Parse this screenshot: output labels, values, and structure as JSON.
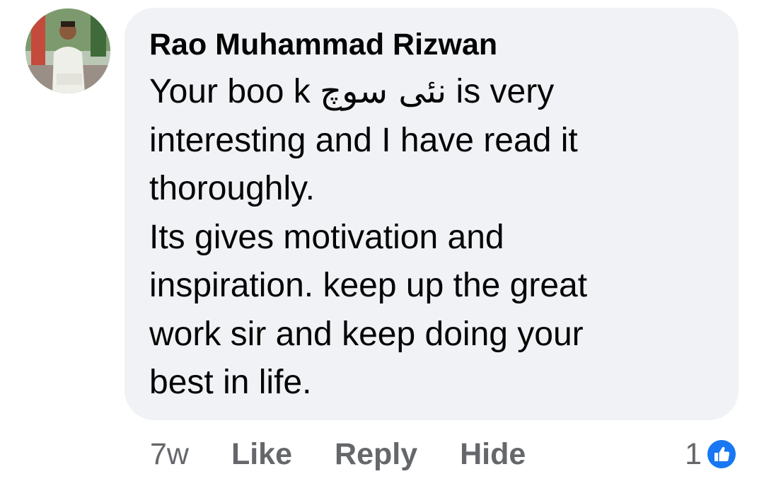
{
  "comment": {
    "author": "Rao Muhammad Rizwan",
    "line1_prefix": "Your boo k ",
    "line1_urdu": "نئی سوچ",
    "line1_suffix": " is very",
    "lines": [
      "interesting and I have read it",
      "thoroughly.",
      "Its gives motivation and",
      "inspiration. keep up the great",
      "work sir and keep doing your",
      "best in life."
    ]
  },
  "actions": {
    "timestamp": "7w",
    "like_label": "Like",
    "reply_label": "Reply",
    "hide_label": "Hide"
  },
  "reactions": {
    "count": "1",
    "icon": "like-thumbs-up-icon",
    "color": "#1877f2"
  },
  "colors": {
    "bubble": "#f0f2f5",
    "secondary_text": "#65676b",
    "primary_text": "#050505"
  }
}
